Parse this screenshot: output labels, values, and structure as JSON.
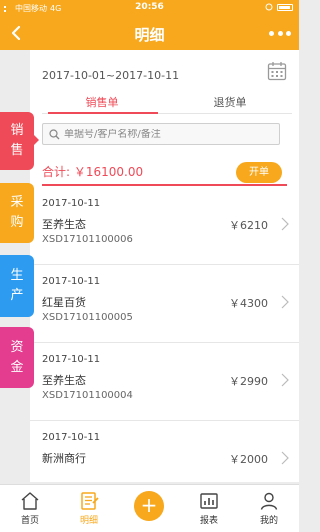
{
  "status_bar": {
    "carrier": "中国移动",
    "network": "4G",
    "time": "20:56"
  },
  "header": {
    "title": "明细"
  },
  "side_tabs": [
    {
      "label": "销售",
      "color": "#ef4a57",
      "active": true
    },
    {
      "label": "采购",
      "color": "#f7a81c"
    },
    {
      "label": "生产",
      "color": "#2d9bf0"
    },
    {
      "label": "资金",
      "color": "#e43d8f"
    }
  ],
  "filter": {
    "date_range": "2017-10-01~2017-10-11"
  },
  "segments": [
    {
      "label": "销售单",
      "active": true
    },
    {
      "label": "退货单"
    }
  ],
  "search": {
    "placeholder": "单据号/客户名称/备注"
  },
  "summary": {
    "total": "合计: ￥16100.00",
    "open_button": "开单"
  },
  "orders": [
    {
      "date": "2017-10-11",
      "name": "至养生态",
      "code": "XSD17101100006",
      "amount": "￥6210"
    },
    {
      "date": "2017-10-11",
      "name": "红星百货",
      "code": "XSD17101100005",
      "amount": "￥4300"
    },
    {
      "date": "2017-10-11",
      "name": "至养生态",
      "code": "XSD17101100004",
      "amount": "￥2990"
    },
    {
      "date": "2017-10-11",
      "name": "新洲商行",
      "code": "",
      "amount": "￥2000"
    }
  ],
  "tab_bar": [
    {
      "label": "首页"
    },
    {
      "label": "明细",
      "active": true
    },
    {
      "label": ""
    },
    {
      "label": "报表"
    },
    {
      "label": "我的"
    }
  ],
  "colors": {
    "accent": "#f7a81c",
    "sales": "#ef4a57"
  }
}
